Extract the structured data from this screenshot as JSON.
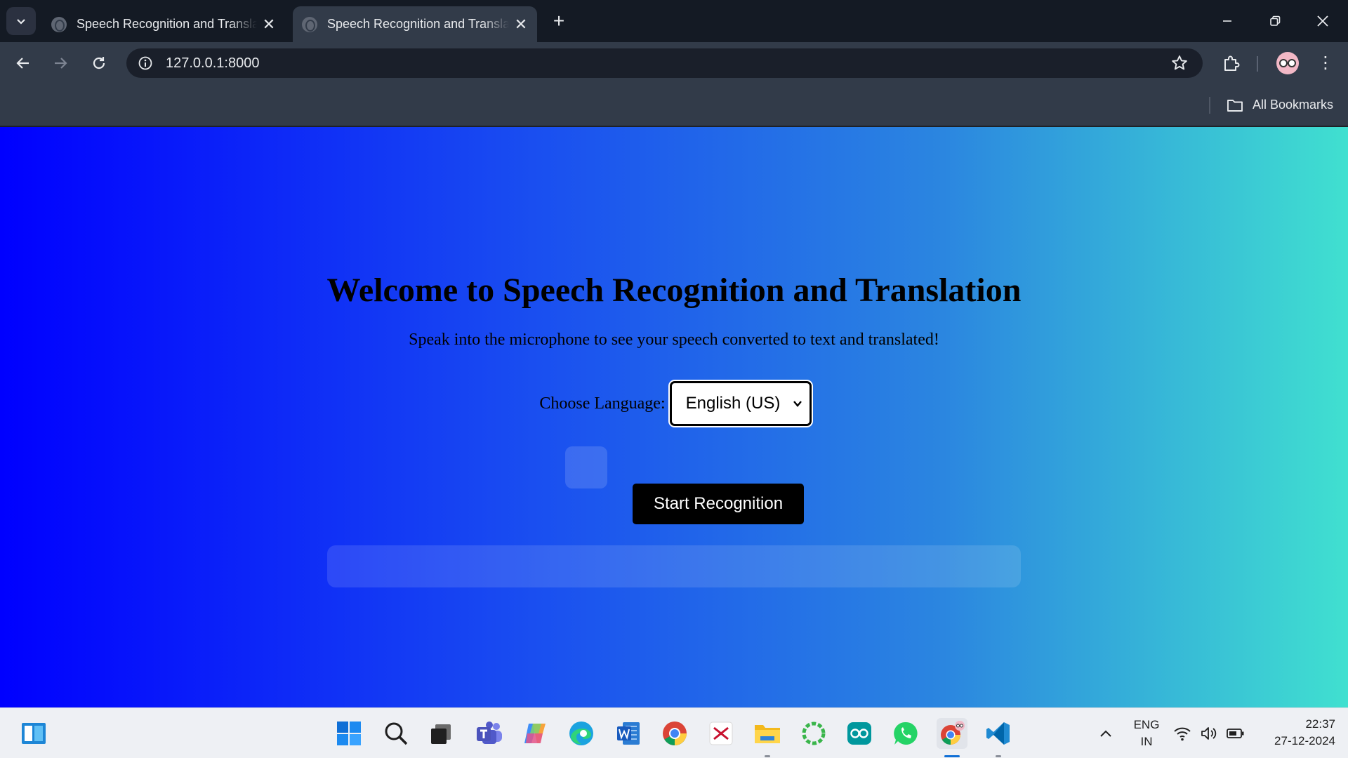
{
  "browser": {
    "tabs": [
      {
        "title": "Speech Recognition and Translation",
        "active": false
      },
      {
        "title": "Speech Recognition and Translation",
        "active": true
      }
    ],
    "new_tab_label": "+",
    "url": "127.0.0.1:8000",
    "bookmarks_label": "All Bookmarks"
  },
  "page": {
    "title": "Welcome to Speech Recognition and Translation",
    "subtitle": "Speak into the microphone to see your speech converted to text and translated!",
    "language_label": "Choose Language:",
    "language_selected": "English (US)",
    "start_button": "Start Recognition",
    "output_text": ""
  },
  "taskbar": {
    "apps": [
      "widgets-icon",
      "start-icon",
      "search-icon",
      "task-view-icon",
      "teams-icon",
      "copilot-icon",
      "edge-icon",
      "word-icon",
      "chrome-icon",
      "anydesk-icon",
      "file-explorer-icon",
      "app-ring-icon",
      "arduino-icon",
      "whatsapp-icon",
      "chrome-profile-icon",
      "vscode-icon"
    ],
    "tray": {
      "lang_top": "ENG",
      "lang_bottom": "IN",
      "time": "22:37",
      "date": "27-12-2024"
    }
  },
  "colors": {
    "gradient_start": "#0000ff",
    "gradient_end": "#40e0d0",
    "button_bg": "#000000",
    "chrome_dark": "#141a24",
    "chrome_toolbar": "#323b49"
  }
}
